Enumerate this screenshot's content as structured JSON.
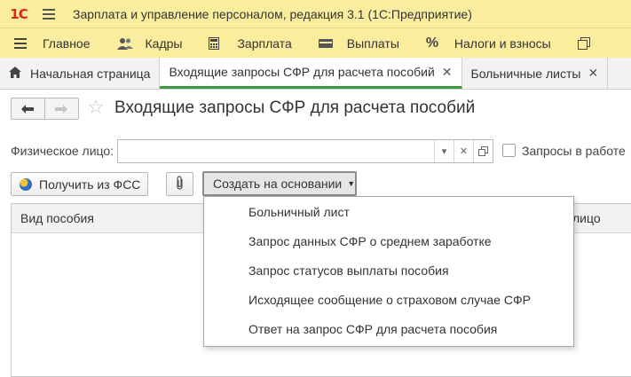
{
  "app": {
    "logo_text": "1С",
    "title": "Зарплата и управление персоналом, редакция 3.1  (1С:Предприятие)"
  },
  "sections": [
    {
      "label": "Главное",
      "icon": "hamburger-icon"
    },
    {
      "label": "Кадры",
      "icon": "people-icon"
    },
    {
      "label": "Зарплата",
      "icon": "calculator-icon"
    },
    {
      "label": "Выплаты",
      "icon": "wallet-icon"
    },
    {
      "label": "Налоги и взносы",
      "icon": "percent-icon"
    },
    {
      "label": "",
      "icon": "documents-icon"
    }
  ],
  "tabs": [
    {
      "label": "Начальная страница",
      "icon": "home-icon",
      "closable": false
    },
    {
      "label": "Входящие запросы СФР для расчета пособий",
      "closable": true,
      "active": true
    },
    {
      "label": "Больничные листы",
      "closable": true
    }
  ],
  "form": {
    "title": "Входящие запросы СФР для расчета пособий",
    "person_label": "Физическое лицо:",
    "person_value": "",
    "in_work_label": "Запросы в работе",
    "in_work_checked": false
  },
  "buttons": {
    "get_fss": "Получить из ФСС",
    "create_based": "Создать на основании"
  },
  "table": {
    "columns": [
      "Вид пособия",
      "лицо"
    ]
  },
  "menu": {
    "items": [
      "Больничный лист",
      "Запрос данных СФР о среднем заработке",
      "Запрос статусов выплаты пособия",
      "Исходящее сообщение о страховом случае СФР",
      "Ответ на запрос СФР для расчета пособия"
    ]
  },
  "colors": {
    "header_bg": "#fbed9e",
    "active_tab_underline": "#3b9a3b",
    "logo": "#d9261c"
  }
}
